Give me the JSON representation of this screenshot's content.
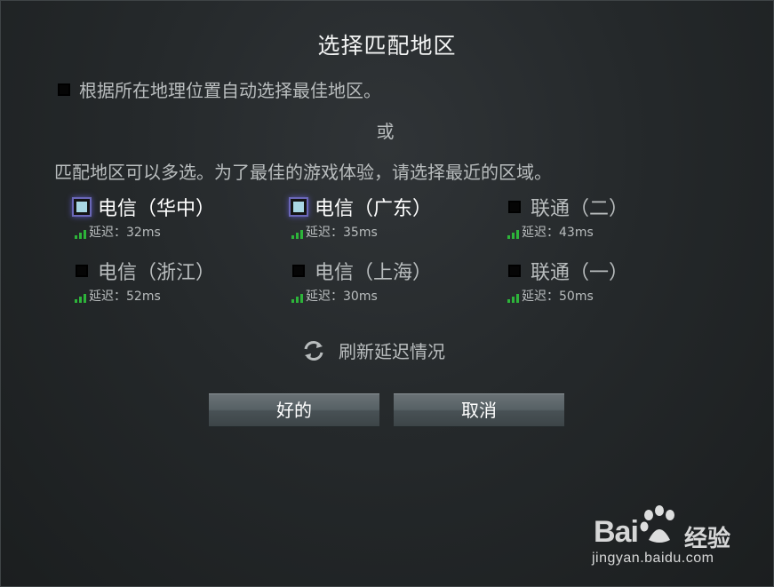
{
  "dialog": {
    "title": "选择匹配地区",
    "auto_select_label": "根据所在地理位置自动选择最佳地区。",
    "or_label": "或",
    "multi_select_hint": "匹配地区可以多选。为了最佳的游戏体验，请选择最近的区域。"
  },
  "regions": [
    {
      "name": "电信（华中）",
      "latency": "延迟：32ms",
      "checked": true
    },
    {
      "name": "电信（广东）",
      "latency": "延迟：35ms",
      "checked": true
    },
    {
      "name": "联通（二）",
      "latency": "延迟：43ms",
      "checked": false
    },
    {
      "name": "电信（浙江）",
      "latency": "延迟：52ms",
      "checked": false
    },
    {
      "name": "电信（上海）",
      "latency": "延迟：30ms",
      "checked": false
    },
    {
      "name": "联通（一）",
      "latency": "延迟：50ms",
      "checked": false
    }
  ],
  "refresh": {
    "label": "刷新延迟情况",
    "icon": "refresh-icon"
  },
  "buttons": {
    "ok_label": "好的",
    "cancel_label": "取消"
  },
  "watermark": {
    "brand_prefix": "Bai",
    "brand_suffix": "经验",
    "url": "jingyan.baidu.com"
  },
  "colors": {
    "signal": "#2db43a",
    "checkbox_checked": "#a9d7e4",
    "checkbox_glow": "#6a67b8"
  }
}
